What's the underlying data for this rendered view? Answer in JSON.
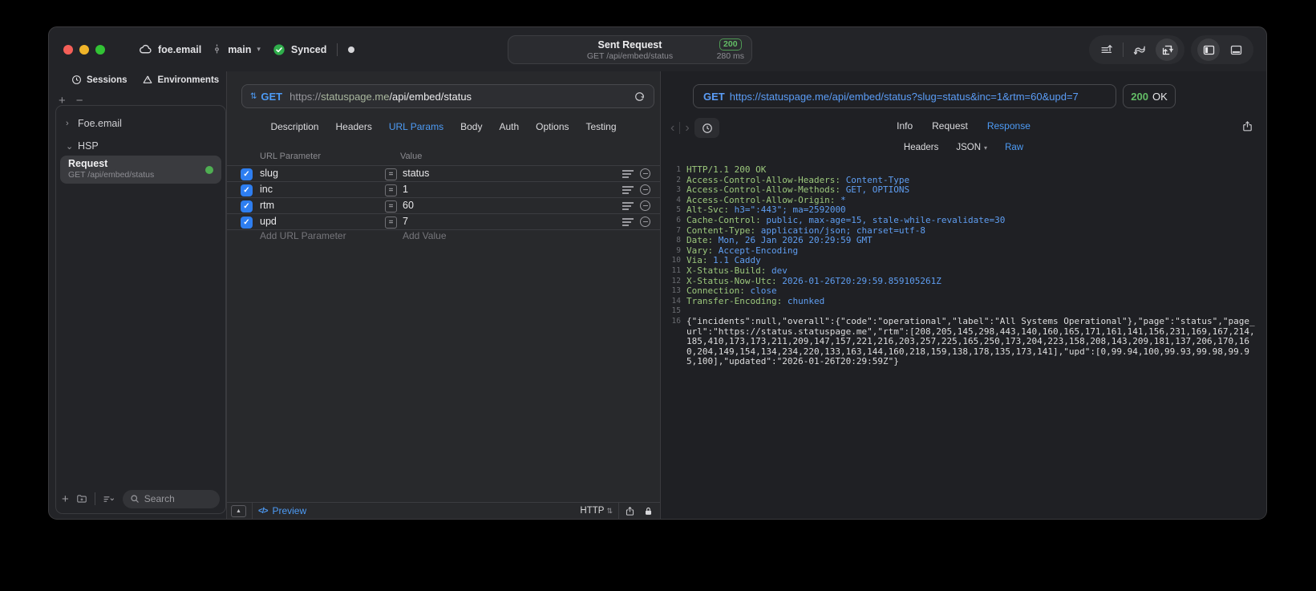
{
  "titlebar": {
    "project": "foe.email",
    "branch": "main",
    "sync_label": "Synced",
    "request_title": "Sent Request",
    "request_subtitle": "GET /api/embed/status",
    "status_code": "200",
    "duration": "280 ms"
  },
  "sidebar": {
    "tabs": [
      {
        "label": "Sessions"
      },
      {
        "label": "Environments"
      }
    ],
    "tree": [
      {
        "label": "Foe.email"
      },
      {
        "label": "HSP"
      }
    ],
    "request_item": {
      "title": "Request",
      "subtitle": "GET /api/embed/status"
    },
    "search_placeholder": "Search"
  },
  "request_panel": {
    "method": "GET",
    "url_scheme": "https://",
    "url_host": "statuspage.me",
    "url_path": "/api/embed/status",
    "tabs": [
      "Description",
      "Headers",
      "URL Params",
      "Body",
      "Auth",
      "Options",
      "Testing"
    ],
    "active_tab": "URL Params",
    "table": {
      "name_header": "URL Parameter",
      "value_header": "Value",
      "rows": [
        {
          "name": "slug",
          "value": "status",
          "checked": true
        },
        {
          "name": "inc",
          "value": "1",
          "checked": true
        },
        {
          "name": "rtm",
          "value": "60",
          "checked": true
        },
        {
          "name": "upd",
          "value": "7",
          "checked": true
        }
      ],
      "add_name_label": "Add URL Parameter",
      "add_value_label": "Add Value"
    },
    "footer": {
      "preview_label": "Preview",
      "protocol_label": "HTTP"
    }
  },
  "response_panel": {
    "method": "GET",
    "url": "https://statuspage.me/api/embed/status?slug=status&inc=1&rtm=60&upd=7",
    "status_code": "200",
    "status_text": "OK",
    "tabs": [
      "Info",
      "Request",
      "Response"
    ],
    "active_tab": "Response",
    "subtabs": [
      {
        "label": "Headers"
      },
      {
        "label": "JSON",
        "chevron": true
      },
      {
        "label": "Raw"
      }
    ],
    "active_subtab": "Raw",
    "lines": [
      {
        "num": 1,
        "key": "HTTP/1.1 200 OK",
        "value": ""
      },
      {
        "num": 2,
        "key": "Access-Control-Allow-Headers: ",
        "value": "Content-Type"
      },
      {
        "num": 3,
        "key": "Access-Control-Allow-Methods: ",
        "value": "GET, OPTIONS"
      },
      {
        "num": 4,
        "key": "Access-Control-Allow-Origin: ",
        "value": "*"
      },
      {
        "num": 5,
        "key": "Alt-Svc: ",
        "value": "h3=\":443\"; ma=2592000"
      },
      {
        "num": 6,
        "key": "Cache-Control: ",
        "value": "public, max-age=15, stale-while-revalidate=30"
      },
      {
        "num": 7,
        "key": "Content-Type: ",
        "value": "application/json; charset=utf-8"
      },
      {
        "num": 8,
        "key": "Date: ",
        "value": "Mon, 26 Jan 2026 20:29:59 GMT"
      },
      {
        "num": 9,
        "key": "Vary: ",
        "value": "Accept-Encoding"
      },
      {
        "num": 10,
        "key": "Via: ",
        "value": "1.1 Caddy"
      },
      {
        "num": 11,
        "key": "X-Status-Build: ",
        "value": "dev"
      },
      {
        "num": 12,
        "key": "X-Status-Now-Utc: ",
        "value": "2026-01-26T20:29:59.859105261Z"
      },
      {
        "num": 13,
        "key": "Connection: ",
        "value": "close"
      },
      {
        "num": 14,
        "key": "Transfer-Encoding: ",
        "value": "chunked"
      },
      {
        "num": 15,
        "key": "",
        "value": ""
      },
      {
        "num": 16,
        "body": "{\"incidents\":null,\"overall\":{\"code\":\"operational\",\"label\":\"All Systems Operational\"},\"page\":\"status\",\"page_url\":\"https://status.statuspage.me\",\"rtm\":[208,205,145,298,443,140,160,165,171,161,141,156,231,169,167,214,185,410,173,173,211,209,147,157,221,216,203,257,225,165,250,173,204,223,158,208,143,209,181,137,206,170,160,204,149,154,134,234,220,133,163,144,160,218,159,138,178,135,173,141],\"upd\":[0,99.94,100,99.93,99.98,99.95,100],\"updated\":\"2026-01-26T20:29:59Z\"}"
      }
    ]
  },
  "colors": {
    "accent_blue": "#4d9bf5",
    "status_green": "#63bd66",
    "header_key_green": "#9cc87c",
    "header_value_blue": "#5f9ef2",
    "checkbox_blue": "#2e7ef0"
  }
}
